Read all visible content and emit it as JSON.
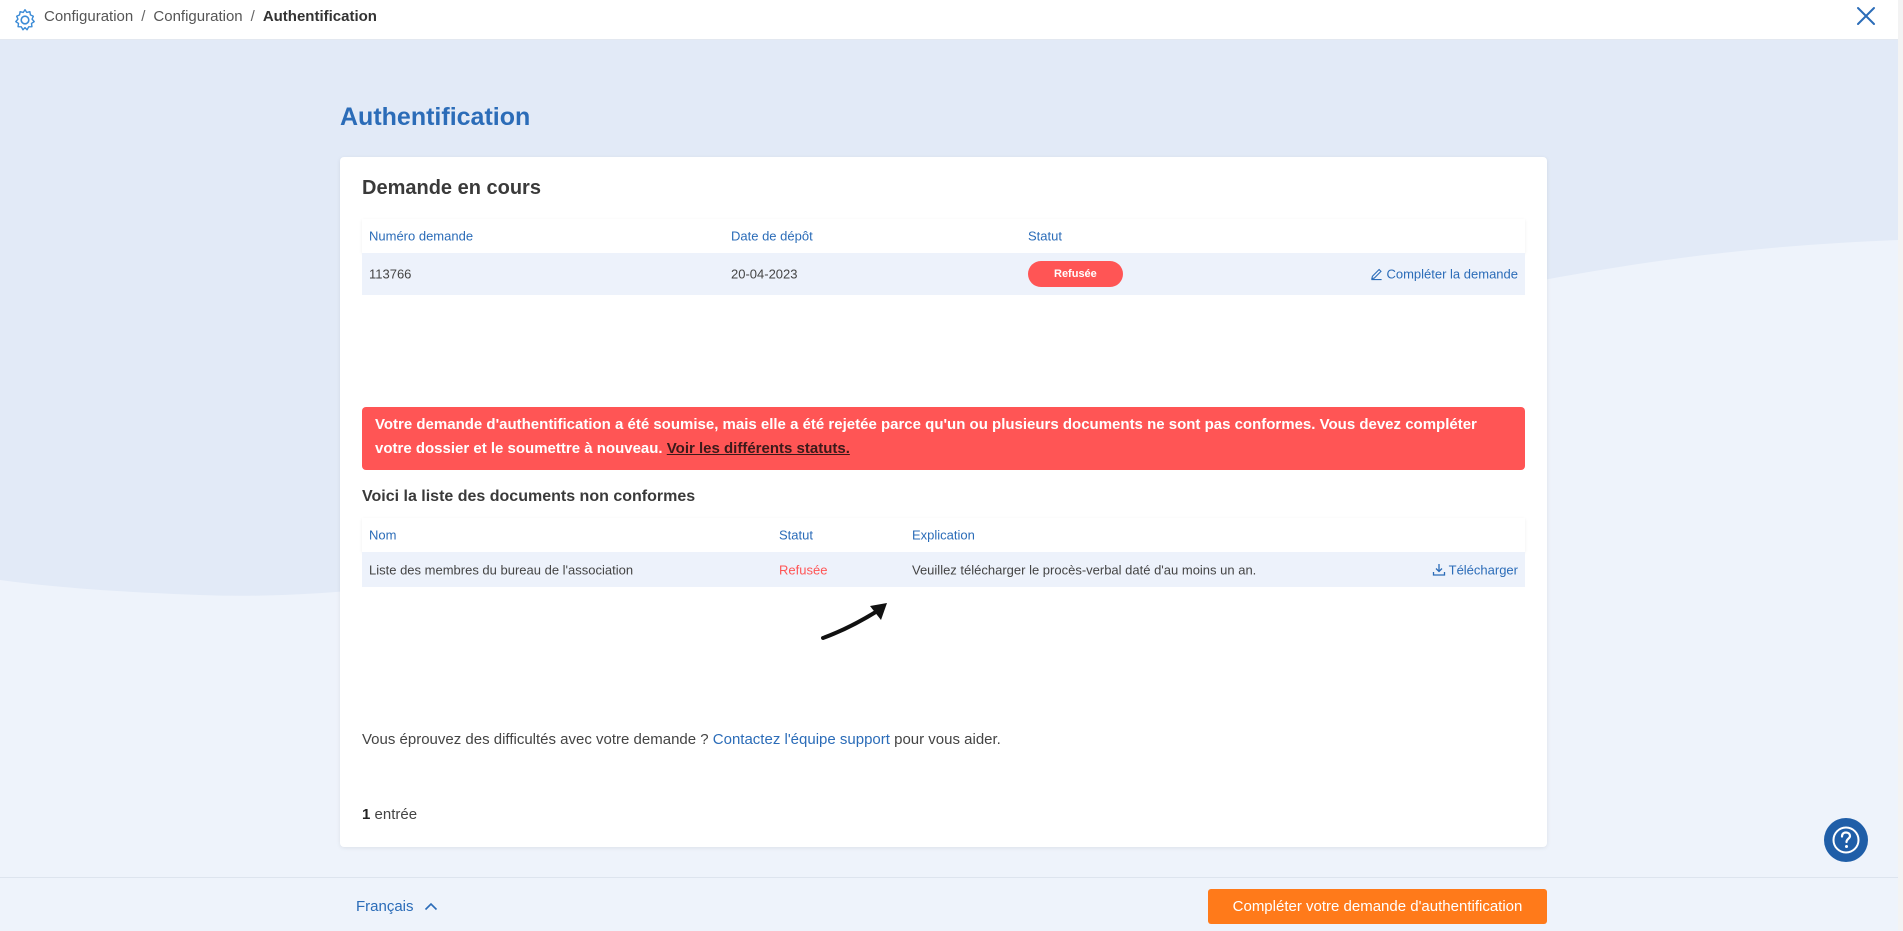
{
  "header": {
    "breadcrumb": [
      "Configuration",
      "Configuration",
      "Authentification"
    ],
    "icons": {
      "settings": "gear-icon",
      "close": "close-icon"
    }
  },
  "page": {
    "title": "Authentification"
  },
  "request": {
    "title": "Demande en cours",
    "columns": [
      "Numéro demande",
      "Date de dépôt",
      "Statut"
    ],
    "row": {
      "number": "113766",
      "date": "20-04-2023",
      "status": "Refusée",
      "action": "Compléter la demande"
    }
  },
  "alert": {
    "message": "Votre demande d'authentification a été soumise, mais elle a été rejetée parce qu'un ou plusieurs documents ne sont pas conformes. Vous devez compléter votre dossier et le soumettre à nouveau.",
    "link": "Voir les différents statuts."
  },
  "documents": {
    "title": "Voici la liste des documents non conformes",
    "columns": [
      "Nom",
      "Statut",
      "Explication"
    ],
    "rows": [
      {
        "name": "Liste des membres du bureau de l'association",
        "status": "Refusée",
        "explanation": "Veuillez télécharger le procès-verbal daté d'au moins un an.",
        "action": "Télécharger"
      }
    ]
  },
  "support": {
    "before": "Vous éprouvez des difficultés avec votre demande ?",
    "link": "Contactez l'équipe support",
    "after": "pour vous aider."
  },
  "entries": {
    "count": "1",
    "label": "entrée"
  },
  "footer": {
    "language": "Français",
    "cta": "Compléter votre demande d'authentification"
  },
  "colors": {
    "accent": "#2b6cb8",
    "danger": "#ff5555",
    "cta": "#ff7a1a",
    "help": "#1f5ea8"
  }
}
